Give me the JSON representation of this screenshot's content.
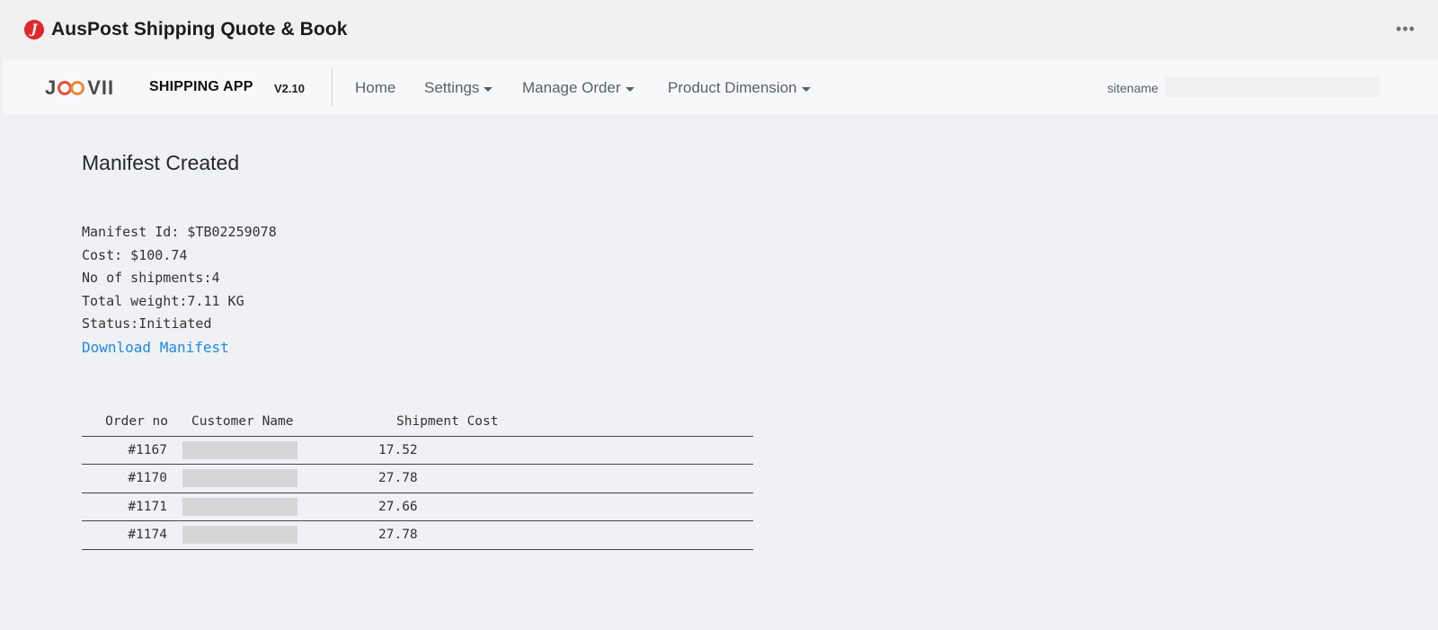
{
  "window": {
    "title": "AusPost Shipping Quote & Book",
    "app_icon_glyph": "J",
    "more_icon": "ellipsis-icon"
  },
  "navbar": {
    "logo_text": "JOOVII",
    "brand": "SHIPPING APP",
    "version": "V2.10",
    "items": [
      {
        "label": "Home",
        "dropdown": false
      },
      {
        "label": "Settings",
        "dropdown": true
      },
      {
        "label": "Manage Order",
        "dropdown": true
      },
      {
        "label": "Product Dimension",
        "dropdown": true
      }
    ],
    "site_label": "sitename"
  },
  "manifest": {
    "title": "Manifest Created",
    "id_line": "Manifest Id: $TB02259078",
    "cost_line": "Cost: $100.74",
    "shipments_line": "No of shipments:4",
    "weight_line": "Total weight:7.11 KG",
    "status_line": "Status:Initiated",
    "download_label": "Download Manifest"
  },
  "table": {
    "headers": [
      "Order no",
      "Customer Name",
      "Shipment Cost"
    ],
    "rows": [
      {
        "order": "#1167",
        "cost": "17.52"
      },
      {
        "order": "#1170",
        "cost": "27.78"
      },
      {
        "order": "#1171",
        "cost": "27.66"
      },
      {
        "order": "#1174",
        "cost": "27.78"
      }
    ]
  },
  "colors": {
    "link": "#1e88e5",
    "logo_accent": "#e5503a",
    "app_icon": "#e0282a"
  }
}
